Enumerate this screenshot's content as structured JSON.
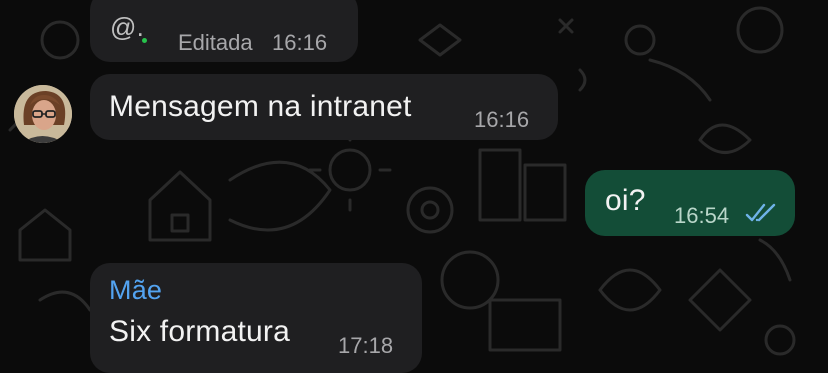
{
  "messages": [
    {
      "mention_symbol": "@.",
      "edited_label": "Editada",
      "time": "16:16"
    },
    {
      "text": "Mensagem na intranet",
      "time": "16:16"
    },
    {
      "text": "oi?",
      "time": "16:54",
      "status": "read-double-check-icon"
    },
    {
      "sender": "Mãe",
      "text": "Six formatura",
      "time": "17:18"
    }
  ],
  "colors": {
    "background": "#0b0b0b",
    "incoming_bubble": "#1f1f21",
    "outgoing_bubble": "#134d37",
    "sender_name": "#53a3f0",
    "read_checks": "#6fb3e8",
    "online_dot": "#27c24c"
  }
}
